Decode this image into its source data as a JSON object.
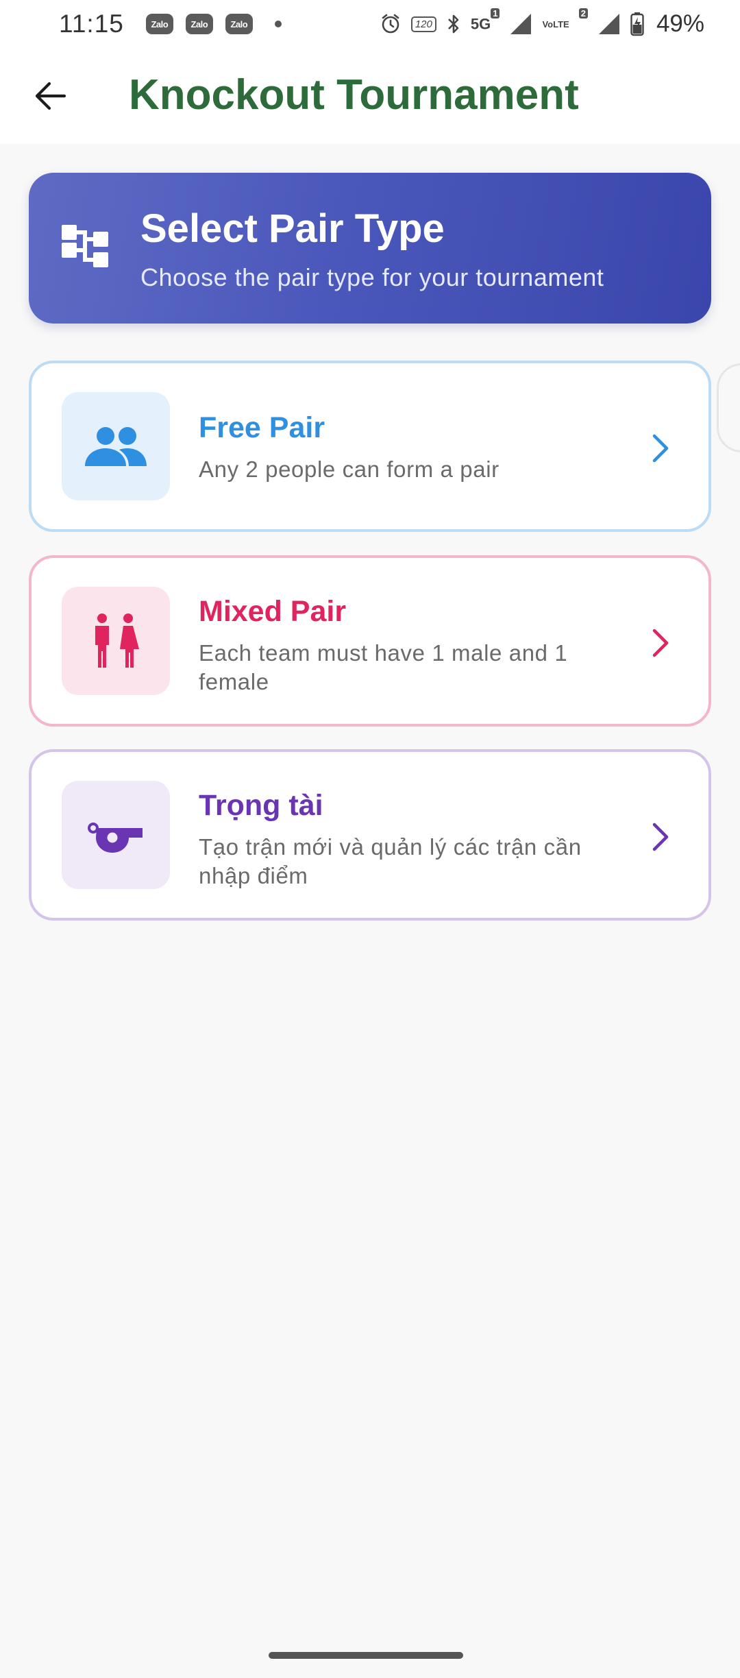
{
  "status_bar": {
    "time": "11:15",
    "notification_apps": [
      "Zalo",
      "Zalo",
      "Zalo"
    ],
    "refresh_rate": "120",
    "network": "5G",
    "sim1_badge": "1",
    "volte": "VoLTE",
    "sim2_badge": "2",
    "battery": "49%"
  },
  "app_bar": {
    "title": "Knockout Tournament",
    "back_icon": "arrow-left-icon"
  },
  "banner": {
    "title": "Select Pair Type",
    "subtitle": "Choose the pair type for your tournament",
    "icon": "bracket-icon"
  },
  "options": [
    {
      "title": "Free Pair",
      "description": "Any 2 people can form a pair",
      "icon": "people-icon",
      "accent": "#2f8fe0"
    },
    {
      "title": "Mixed Pair",
      "description": "Each team must have 1 male and 1 female",
      "icon": "male-female-icon",
      "accent": "#e0245e"
    },
    {
      "title": "Trọng tài",
      "description": "Tạo trận mới và quản lý các trận cần nhập điểm",
      "icon": "whistle-icon",
      "accent": "#6a35b3"
    }
  ],
  "colors": {
    "title_green": "#2e6b3a",
    "banner_start": "#5e6bc4",
    "banner_end": "#3a46ab",
    "background": "#f8f8f8"
  }
}
